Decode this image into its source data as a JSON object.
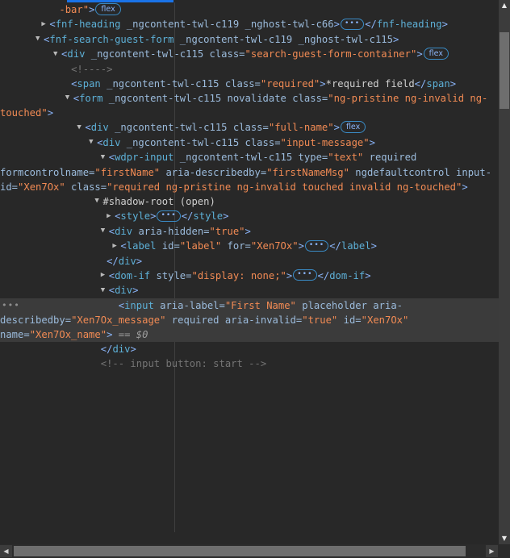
{
  "panel": {
    "name": "Chrome DevTools Elements panel",
    "theme": "dark",
    "colors": {
      "background": "#282828",
      "selected_row": "#3b3b3b",
      "accent_blue": "#1a73e8",
      "tag_name": "#5db0d7",
      "attribute_name": "#9bbbdc",
      "attribute_value": "#f28b54",
      "comment": "#747474",
      "text_node": "#cfcfcf",
      "scrollbar_thumb": "#6e6e6e",
      "scrollbar_track": "#3c3c3c",
      "badge_border": "#3a8cc7"
    }
  },
  "scrollbars": {
    "vertical": {
      "up_arrow": "▲",
      "down_arrow": "▼"
    },
    "horizontal": {
      "left_arrow": "◀",
      "right_arrow": "▶"
    }
  },
  "badges": {
    "flex": "flex",
    "ellipsis": "•••",
    "gutter_dots": "•••"
  },
  "dom_tree": {
    "rows": [
      {
        "id": "row-bar-flex",
        "indent": 0,
        "toggle": "none",
        "selected": false,
        "parts": [
          {
            "t": "pad",
            "v": "          "
          },
          {
            "t": "val",
            "v": "-bar\""
          },
          {
            "t": "tagpunct",
            "v": ">"
          },
          {
            "t": "badge-flex",
            "v": "flex"
          }
        ]
      },
      {
        "id": "row-fnf-heading",
        "indent": 0,
        "toggle": "none",
        "selected": false,
        "parts": [
          {
            "t": "pad",
            "v": "       "
          },
          {
            "t": "tw-closed",
            "v": ""
          },
          {
            "t": "tagpunct",
            "v": "<"
          },
          {
            "t": "tag",
            "v": "fnf-heading"
          },
          {
            "t": "attr",
            "v": " _ngcontent-twl-c119"
          },
          {
            "t": "attr",
            "v": " _nghost-twl-c66"
          },
          {
            "t": "tagpunct",
            "v": ">"
          },
          {
            "t": "badge-dots",
            "v": "•••"
          },
          {
            "t": "tagpunct",
            "v": "</"
          },
          {
            "t": "tag",
            "v": "fnf-heading"
          },
          {
            "t": "tagpunct",
            "v": ">"
          }
        ]
      },
      {
        "id": "row-fnf-search-guest-form",
        "indent": 0,
        "toggle": "open",
        "selected": false,
        "parts": [
          {
            "t": "pad",
            "v": "      "
          },
          {
            "t": "tw-open",
            "v": ""
          },
          {
            "t": "tagpunct",
            "v": "<"
          },
          {
            "t": "tag",
            "v": "fnf-search-guest-form"
          },
          {
            "t": "attr",
            "v": " _ngcontent-twl-c119"
          },
          {
            "t": "attr",
            "v": " _nghost-twl-c115"
          },
          {
            "t": "tagpunct",
            "v": ">"
          }
        ]
      },
      {
        "id": "row-div-search-guest-form-container",
        "indent": 0,
        "toggle": "open",
        "selected": false,
        "parts": [
          {
            "t": "pad",
            "v": "         "
          },
          {
            "t": "tw-open",
            "v": ""
          },
          {
            "t": "tagpunct",
            "v": "<"
          },
          {
            "t": "tag",
            "v": "div"
          },
          {
            "t": "attr",
            "v": " _ngcontent-twl-c115"
          },
          {
            "t": "attr",
            "v": " class="
          },
          {
            "t": "val",
            "v": "\"search-guest-form-container\""
          },
          {
            "t": "tagpunct",
            "v": ">"
          },
          {
            "t": "badge-flex",
            "v": "flex"
          }
        ]
      },
      {
        "id": "row-empty-comment",
        "indent": 0,
        "toggle": "none",
        "selected": false,
        "parts": [
          {
            "t": "pad",
            "v": "            "
          },
          {
            "t": "comment",
            "v": "<!---->"
          }
        ]
      },
      {
        "id": "row-span-required",
        "indent": 0,
        "toggle": "none",
        "selected": false,
        "parts": [
          {
            "t": "pad",
            "v": "            "
          },
          {
            "t": "tagpunct",
            "v": "<"
          },
          {
            "t": "tag",
            "v": "span"
          },
          {
            "t": "attr",
            "v": " _ngcontent-twl-c115"
          },
          {
            "t": "attr",
            "v": " class="
          },
          {
            "t": "val",
            "v": "\"required\""
          },
          {
            "t": "tagpunct",
            "v": ">"
          },
          {
            "t": "text",
            "v": "*required field"
          },
          {
            "t": "tagpunct",
            "v": "</"
          },
          {
            "t": "tag",
            "v": "span"
          },
          {
            "t": "tagpunct",
            "v": ">"
          }
        ]
      },
      {
        "id": "row-form",
        "indent": 0,
        "toggle": "open",
        "selected": false,
        "parts": [
          {
            "t": "pad",
            "v": "           "
          },
          {
            "t": "tw-open",
            "v": ""
          },
          {
            "t": "tagpunct",
            "v": "<"
          },
          {
            "t": "tag",
            "v": "form"
          },
          {
            "t": "attr",
            "v": " _ngcontent-twl-c115"
          },
          {
            "t": "attr",
            "v": " novalidate"
          },
          {
            "t": "attr",
            "v": " class="
          },
          {
            "t": "val",
            "v": "\"ng-pristine ng-invalid ng-touched\""
          },
          {
            "t": "tagpunct",
            "v": ">"
          }
        ]
      },
      {
        "id": "row-div-full-name",
        "indent": 0,
        "toggle": "open",
        "selected": false,
        "parts": [
          {
            "t": "pad",
            "v": "             "
          },
          {
            "t": "tw-open",
            "v": ""
          },
          {
            "t": "tagpunct",
            "v": "<"
          },
          {
            "t": "tag",
            "v": "div"
          },
          {
            "t": "attr",
            "v": " _ngcontent-twl-c115"
          },
          {
            "t": "attr",
            "v": " class="
          },
          {
            "t": "val",
            "v": "\"full-name\""
          },
          {
            "t": "tagpunct",
            "v": ">"
          },
          {
            "t": "badge-flex",
            "v": "flex"
          }
        ]
      },
      {
        "id": "row-div-input-message",
        "indent": 0,
        "toggle": "open",
        "selected": false,
        "parts": [
          {
            "t": "pad",
            "v": "               "
          },
          {
            "t": "tw-open",
            "v": ""
          },
          {
            "t": "tagpunct",
            "v": "<"
          },
          {
            "t": "tag",
            "v": "div"
          },
          {
            "t": "attr",
            "v": " _ngcontent-twl-c115"
          },
          {
            "t": "attr",
            "v": " class="
          },
          {
            "t": "val",
            "v": "\"input-message\""
          },
          {
            "t": "tagpunct",
            "v": ">"
          }
        ]
      },
      {
        "id": "row-wdpr-input",
        "indent": 0,
        "toggle": "open",
        "selected": false,
        "parts": [
          {
            "t": "pad",
            "v": "                 "
          },
          {
            "t": "tw-open",
            "v": ""
          },
          {
            "t": "tagpunct",
            "v": "<"
          },
          {
            "t": "tag",
            "v": "wdpr-input"
          },
          {
            "t": "attr",
            "v": " _ngcontent-twl-c115"
          },
          {
            "t": "attr",
            "v": " type="
          },
          {
            "t": "val",
            "v": "\"text\""
          },
          {
            "t": "attr",
            "v": " required"
          },
          {
            "t": "attr",
            "v": " formcontrolname="
          },
          {
            "t": "val",
            "v": "\"firstName\""
          },
          {
            "t": "attr",
            "v": " aria-describedby="
          },
          {
            "t": "val",
            "v": "\"firstNameMsg\""
          },
          {
            "t": "attr",
            "v": " ngdefaultcontrol"
          },
          {
            "t": "attr",
            "v": " input-id="
          },
          {
            "t": "val",
            "v": "\"Xen7Ox\""
          },
          {
            "t": "attr",
            "v": " class="
          },
          {
            "t": "val",
            "v": "\"required ng-pristine ng-invalid touched invalid ng-touched\""
          },
          {
            "t": "tagpunct",
            "v": ">"
          }
        ]
      },
      {
        "id": "row-shadow-root",
        "indent": 0,
        "toggle": "open",
        "selected": false,
        "parts": [
          {
            "t": "pad",
            "v": "                "
          },
          {
            "t": "tw-open",
            "v": ""
          },
          {
            "t": "shadow",
            "v": "#shadow-root (open)"
          }
        ]
      },
      {
        "id": "row-style",
        "indent": 0,
        "toggle": "closed",
        "selected": false,
        "parts": [
          {
            "t": "pad",
            "v": "                  "
          },
          {
            "t": "tw-closed",
            "v": ""
          },
          {
            "t": "tagpunct",
            "v": "<"
          },
          {
            "t": "tag",
            "v": "style"
          },
          {
            "t": "tagpunct",
            "v": ">"
          },
          {
            "t": "badge-dots",
            "v": "•••"
          },
          {
            "t": "tagpunct",
            "v": "</"
          },
          {
            "t": "tag",
            "v": "style"
          },
          {
            "t": "tagpunct",
            "v": ">"
          }
        ]
      },
      {
        "id": "row-div-aria-hidden",
        "indent": 0,
        "toggle": "open",
        "selected": false,
        "parts": [
          {
            "t": "pad",
            "v": "                 "
          },
          {
            "t": "tw-open",
            "v": ""
          },
          {
            "t": "tagpunct",
            "v": "<"
          },
          {
            "t": "tag",
            "v": "div"
          },
          {
            "t": "attr",
            "v": " aria-hidden="
          },
          {
            "t": "val",
            "v": "\"true\""
          },
          {
            "t": "tagpunct",
            "v": ">"
          }
        ]
      },
      {
        "id": "row-label",
        "indent": 0,
        "toggle": "closed",
        "selected": false,
        "parts": [
          {
            "t": "pad",
            "v": "                   "
          },
          {
            "t": "tw-closed",
            "v": ""
          },
          {
            "t": "tagpunct",
            "v": "<"
          },
          {
            "t": "tag",
            "v": "label"
          },
          {
            "t": "attr",
            "v": " id="
          },
          {
            "t": "val",
            "v": "\"label\""
          },
          {
            "t": "attr",
            "v": " for="
          },
          {
            "t": "val",
            "v": "\"Xen7Ox\""
          },
          {
            "t": "tagpunct",
            "v": ">"
          },
          {
            "t": "badge-dots",
            "v": "•••"
          },
          {
            "t": "tagpunct",
            "v": "</"
          },
          {
            "t": "tag",
            "v": "label"
          },
          {
            "t": "tagpunct",
            "v": ">"
          }
        ]
      },
      {
        "id": "row-close-div-aria-hidden",
        "indent": 0,
        "toggle": "none",
        "selected": false,
        "parts": [
          {
            "t": "pad",
            "v": "                  "
          },
          {
            "t": "tagpunct",
            "v": "</"
          },
          {
            "t": "tag",
            "v": "div"
          },
          {
            "t": "tagpunct",
            "v": ">"
          }
        ]
      },
      {
        "id": "row-dom-if",
        "indent": 0,
        "toggle": "closed",
        "selected": false,
        "parts": [
          {
            "t": "pad",
            "v": "                 "
          },
          {
            "t": "tw-closed",
            "v": ""
          },
          {
            "t": "tagpunct",
            "v": "<"
          },
          {
            "t": "tag",
            "v": "dom-if"
          },
          {
            "t": "attr",
            "v": " style="
          },
          {
            "t": "val",
            "v": "\"display: none;\""
          },
          {
            "t": "tagpunct",
            "v": ">"
          },
          {
            "t": "badge-dots",
            "v": "•••"
          },
          {
            "t": "tagpunct",
            "v": "</"
          },
          {
            "t": "tag",
            "v": "dom-if"
          },
          {
            "t": "tagpunct",
            "v": ">"
          }
        ]
      },
      {
        "id": "row-div-open",
        "indent": 0,
        "toggle": "open",
        "selected": false,
        "parts": [
          {
            "t": "pad",
            "v": "                 "
          },
          {
            "t": "tw-open",
            "v": ""
          },
          {
            "t": "tagpunct",
            "v": "<"
          },
          {
            "t": "tag",
            "v": "div"
          },
          {
            "t": "tagpunct",
            "v": ">"
          }
        ]
      },
      {
        "id": "row-input-selected",
        "indent": 0,
        "toggle": "none",
        "selected": true,
        "parts": [
          {
            "t": "pad",
            "v": "                    "
          },
          {
            "t": "tagpunct",
            "v": "<"
          },
          {
            "t": "tag",
            "v": "input"
          },
          {
            "t": "attr",
            "v": " aria-label="
          },
          {
            "t": "val",
            "v": "\"First Name\""
          },
          {
            "t": "attr",
            "v": " placeholder"
          },
          {
            "t": "attr",
            "v": " aria-describedby="
          },
          {
            "t": "val",
            "v": "\"Xen7Ox_message\""
          },
          {
            "t": "attr",
            "v": " required"
          },
          {
            "t": "attr",
            "v": " aria-invalid="
          },
          {
            "t": "val",
            "v": "\"true\""
          },
          {
            "t": "attr",
            "v": " id="
          },
          {
            "t": "val",
            "v": "\"Xen7Ox\""
          },
          {
            "t": "attr",
            "v": " name="
          },
          {
            "t": "val",
            "v": "\"Xen7Ox_name\""
          },
          {
            "t": "tagpunct",
            "v": ">"
          },
          {
            "t": "eq",
            "v": " == "
          },
          {
            "t": "dollar",
            "v": "$0"
          }
        ]
      },
      {
        "id": "row-close-div",
        "indent": 0,
        "toggle": "none",
        "selected": false,
        "parts": [
          {
            "t": "pad",
            "v": "                 "
          },
          {
            "t": "tagpunct",
            "v": "</"
          },
          {
            "t": "tag",
            "v": "div"
          },
          {
            "t": "tagpunct",
            "v": ">"
          }
        ]
      },
      {
        "id": "row-comment-input-button-start",
        "indent": 0,
        "toggle": "none",
        "selected": false,
        "parts": [
          {
            "t": "pad",
            "v": "                 "
          },
          {
            "t": "comment",
            "v": "<!-- input button: start -->"
          }
        ]
      }
    ]
  }
}
